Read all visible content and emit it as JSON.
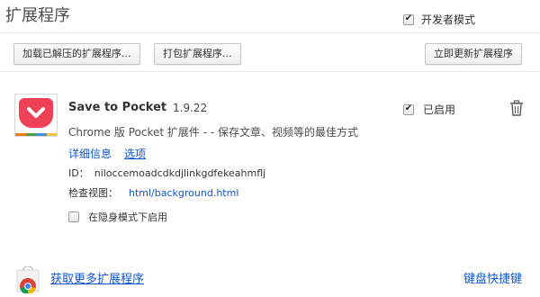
{
  "page": {
    "title": "扩展程序",
    "developer_mode_label": "开发者模式",
    "developer_mode_checked": true
  },
  "toolbar": {
    "load_unpacked": "加载已解压的扩展程序...",
    "pack_extension": "打包扩展程序...",
    "update_now": "立即更新扩展程序"
  },
  "extension": {
    "name": "Save to Pocket",
    "version": "1.9.22",
    "description": "Chrome 版 Pocket 扩展件 -  - 保存文章、视频等的最佳方式",
    "details_link": "详细信息",
    "options_link": "选项",
    "id_label": "ID：",
    "id_value": "niloccemoadcdkdjlinkgdfekeahmflj",
    "inspect_label": "检查视图：",
    "inspect_link": "html/background.html",
    "incognito_label": "在隐身模式下启用",
    "incognito_checked": false,
    "enabled_label": "已启用",
    "enabled_checked": true,
    "icon": "pocket-icon",
    "brand_color": "#ef4056"
  },
  "footer": {
    "get_more": "获取更多扩展程序",
    "keyboard_shortcuts": "键盘快捷键"
  },
  "colors": {
    "link": "#1155cc",
    "pocket_red": "#ef4056",
    "stripe": [
      "#ee7d1a",
      "#4f9f3e",
      "#3f8fd3",
      "#f0c34a"
    ]
  }
}
